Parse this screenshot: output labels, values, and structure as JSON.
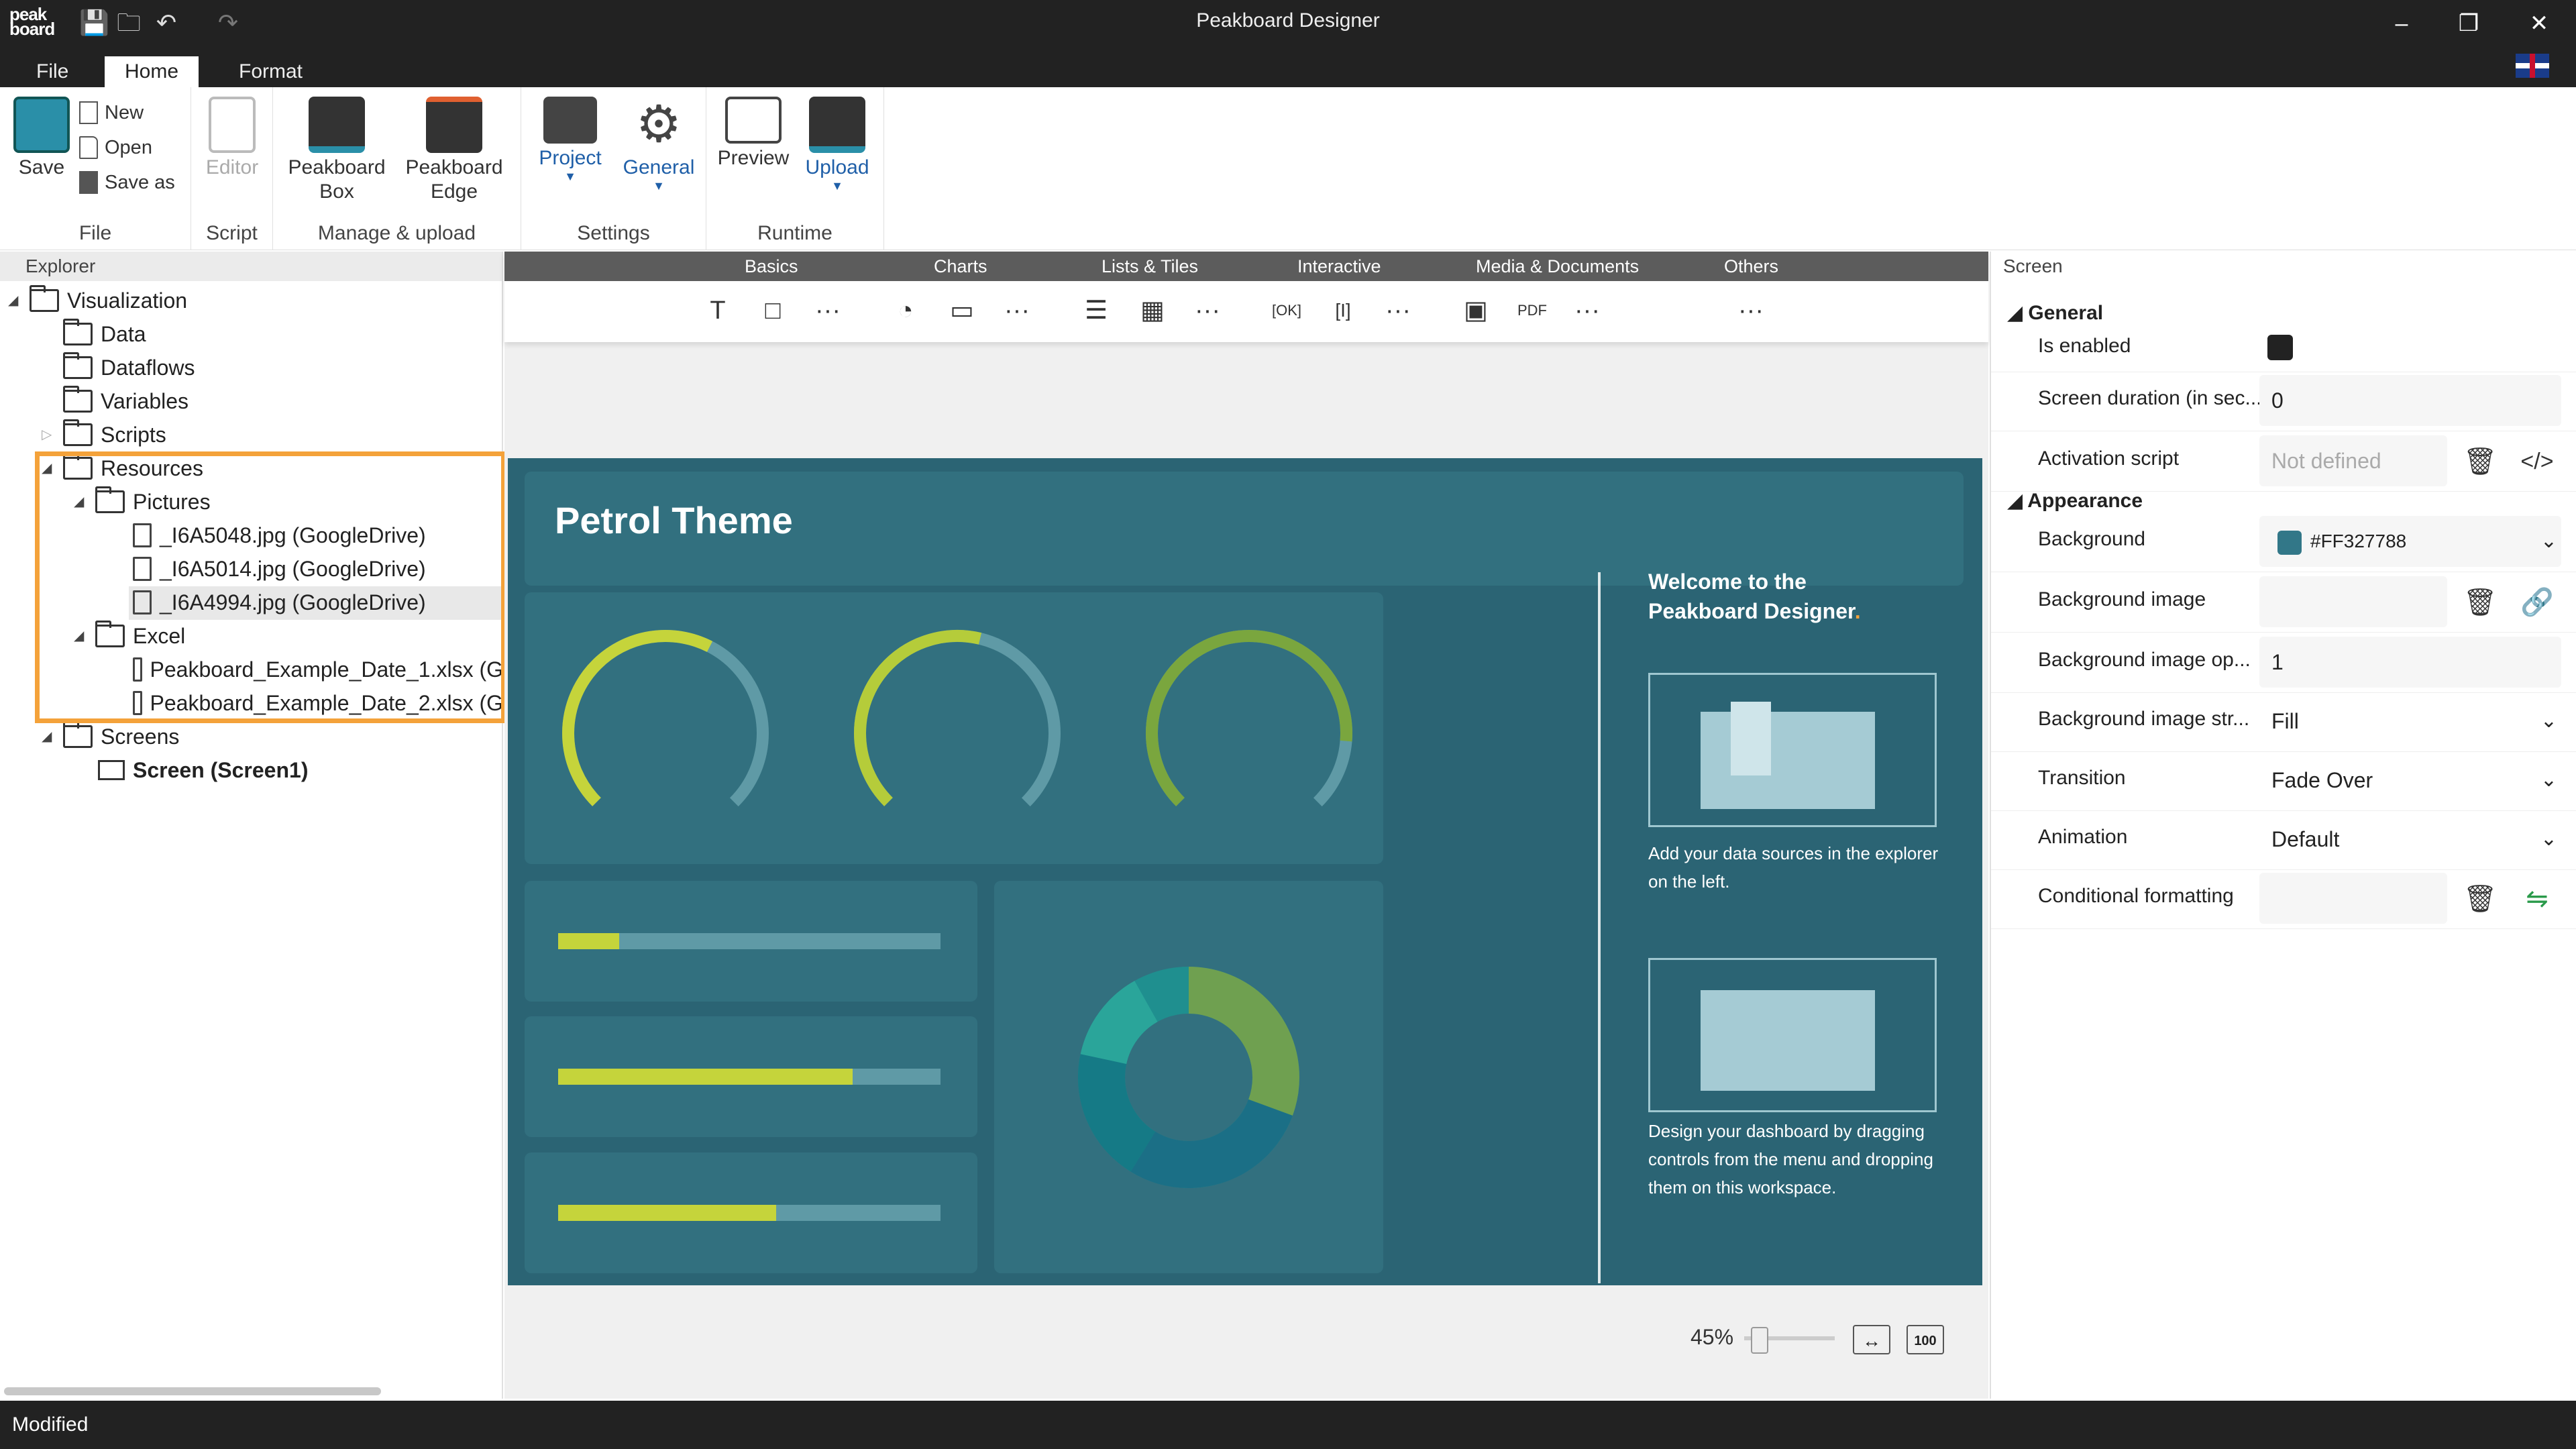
{
  "app": {
    "title": "Peakboard Designer",
    "logo": "peak board",
    "accent": "#1f5fa8",
    "highlight_color": "#f4a23a"
  },
  "menu_tabs": [
    "File",
    "Home",
    "Format"
  ],
  "ribbon": {
    "file": {
      "save": "Save",
      "new": "New",
      "open": "Open",
      "save_as": "Save as",
      "group": "File"
    },
    "script": {
      "editor": "Editor",
      "group": "Script"
    },
    "manage": {
      "box": "Peakboard\nBox",
      "box_l1": "Peakboard",
      "box_l2": "Box",
      "edge_l1": "Peakboard",
      "edge_l2": "Edge",
      "group": "Manage & upload"
    },
    "settings": {
      "project": "Project",
      "general": "General",
      "group": "Settings"
    },
    "runtime": {
      "preview": "Preview",
      "upload": "Upload",
      "group": "Runtime"
    }
  },
  "explorer": {
    "header": "Explorer",
    "nodes": {
      "visualization": "Visualization",
      "data": "Data",
      "dataflows": "Dataflows",
      "variables": "Variables",
      "scripts": "Scripts",
      "resources": "Resources",
      "pictures": "Pictures",
      "pic1": "_I6A5048.jpg (GoogleDrive)",
      "pic2": "_I6A5014.jpg (GoogleDrive)",
      "pic3": "_I6A4994.jpg (GoogleDrive)",
      "excel": "Excel",
      "xl1": "Peakboard_Example_Date_1.xlsx (G",
      "xl2": "Peakboard_Example_Date_2.xlsx (G",
      "screens": "Screens",
      "screen1": "Screen (Screen1)"
    }
  },
  "toolbox": {
    "categories": [
      "Basics",
      "Charts",
      "Lists & Tiles",
      "Interactive",
      "Media & Documents",
      "Others"
    ]
  },
  "board": {
    "title": "Petrol Theme",
    "welcome_l1": "Welcome to the",
    "welcome_l2": "Peakboard Designer",
    "welcome_dot": ".",
    "text1": "Add your data sources in the explorer on the left.",
    "text2": "Design your dashboard by dragging controls from the menu and dropping them on this workspace.",
    "bar_fills": [
      0.16,
      0.77,
      0.57
    ],
    "gauge_values": [
      0.6,
      0.55,
      0.85
    ],
    "background": "#FF327788"
  },
  "zoom": {
    "level": "45%",
    "fit_label": "↔",
    "hundred_label": "100"
  },
  "properties": {
    "header": "Screen",
    "general": "General",
    "appearance": "Appearance",
    "is_enabled": "Is enabled",
    "screen_duration": "Screen duration (in sec...",
    "screen_duration_value": "0",
    "activation_script": "Activation script",
    "activation_script_placeholder": "Not defined",
    "background": "Background",
    "background_value": "#FF327788",
    "background_image": "Background image",
    "background_image_op": "Background image op...",
    "background_image_op_value": "1",
    "background_image_str": "Background image str...",
    "background_image_str_value": "Fill",
    "transition": "Transition",
    "transition_value": "Fade Over",
    "animation": "Animation",
    "animation_value": "Default",
    "conditional_formatting": "Conditional formatting"
  },
  "status": "Modified"
}
